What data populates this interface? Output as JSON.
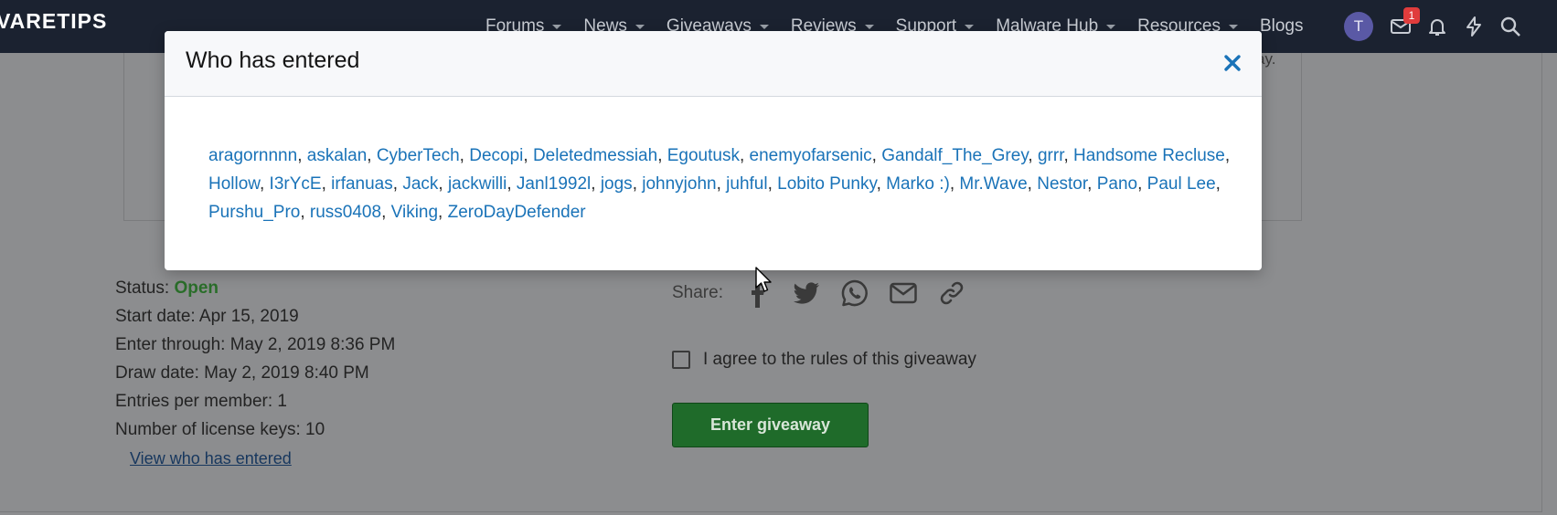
{
  "header": {
    "logo_text": "VARETIPS",
    "nav": [
      {
        "label": "Forums",
        "has_menu": true
      },
      {
        "label": "News",
        "has_menu": true
      },
      {
        "label": "Giveaways",
        "has_menu": true
      },
      {
        "label": "Reviews",
        "has_menu": true
      },
      {
        "label": "Support",
        "has_menu": true
      },
      {
        "label": "Malware Hub",
        "has_menu": true
      },
      {
        "label": "Resources",
        "has_menu": true
      },
      {
        "label": "Blogs",
        "has_menu": false
      }
    ],
    "avatar_initial": "T",
    "inbox_badge": "1",
    "icons": [
      "avatar",
      "inbox-icon",
      "bell-icon",
      "lightning-icon",
      "search-icon"
    ]
  },
  "page": {
    "cut_text": "ay.",
    "details": {
      "status_label": "Status:",
      "status_value": "Open",
      "start_date": "Start date: Apr 15, 2019",
      "enter_through": "Enter through: May 2, 2019 8:36 PM",
      "draw_date": "Draw date: May 2, 2019 8:40 PM",
      "entries_per_member": "Entries per member: 1",
      "license_keys": "Number of license keys: 10"
    },
    "view_link": "View who has entered",
    "share_label": "Share:",
    "share_icons": [
      "facebook-icon",
      "twitter-icon",
      "whatsapp-icon",
      "email-icon",
      "link-icon"
    ],
    "agree_label": "I agree to the rules of this giveaway",
    "enter_button": "Enter giveaway"
  },
  "modal": {
    "title": "Who has entered",
    "entrants": [
      "aragornnnn",
      "askalan",
      "CyberTech",
      "Decopi",
      "Deletedmessiah",
      "Egoutusk",
      "enemyofarsenic",
      "Gandalf_The_Grey",
      "grrr",
      "Handsome Recluse",
      "Hollow",
      "I3rYcE",
      "irfanuas",
      "Jack",
      "jackwilli",
      "Janl1992l",
      "jogs",
      "johnyjohn",
      "juhful",
      "Lobito Punky",
      "Marko :)",
      "Mr.Wave",
      "Nestor",
      "Pano",
      "Paul Lee",
      "Purshu_Pro",
      "russ0408",
      "Viking",
      "ZeroDayDefender"
    ]
  },
  "colors": {
    "overlay_bg": "#8c8d8f",
    "topbar": "#1b2230",
    "link": "#1a73b8",
    "status_open": "#2a6e2a",
    "button": "#1f6b2a",
    "close": "#1a73b8"
  }
}
